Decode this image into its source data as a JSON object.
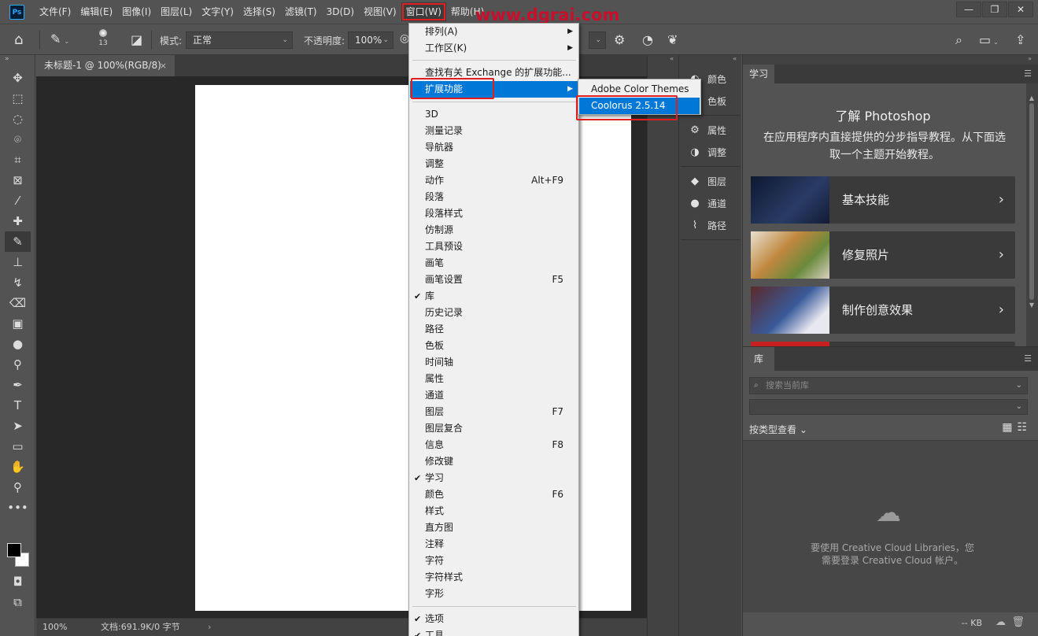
{
  "app": {
    "logo": "Ps",
    "menus": [
      "文件(F)",
      "编辑(E)",
      "图像(I)",
      "图层(L)",
      "文字(Y)",
      "选择(S)",
      "滤镜(T)",
      "3D(D)",
      "视图(V)",
      "窗口(W)",
      "帮助(H)"
    ],
    "active_menu": "窗口(W)",
    "watermark": "www.dgrai.com",
    "window_controls": [
      "—",
      "❐",
      "✕"
    ]
  },
  "options": {
    "brush_size": "13",
    "mode_label": "模式:",
    "mode_value": "正常",
    "opacity_label": "不透明度:",
    "opacity_value": "100%"
  },
  "document": {
    "tab_title": "未标题-1 @ 100%(RGB/8)",
    "tab_close": "×",
    "zoom": "100%",
    "doc_info": "文档:691.9K/0 字节",
    "status_arrow": "›"
  },
  "right_panels": {
    "group1": [
      {
        "icon": "◐",
        "label": "颜色"
      },
      {
        "icon": "▦",
        "label": "色板"
      }
    ],
    "group2": [
      {
        "icon": "⚙",
        "label": "属性"
      },
      {
        "icon": "◑",
        "label": "调整"
      }
    ],
    "group3": [
      {
        "icon": "◆",
        "label": "图层"
      },
      {
        "icon": "●",
        "label": "通道"
      },
      {
        "icon": "⌇",
        "label": "路径"
      }
    ]
  },
  "learn": {
    "tab": "学习",
    "title": "了解 Photoshop",
    "description": "在应用程序内直接提供的分步指导教程。从下面选取一个主题开始教程。",
    "cards": [
      {
        "label": "基本技能",
        "thumb_color": "#1d2a44"
      },
      {
        "label": "修复照片",
        "thumb_color": "#8a6a3a"
      },
      {
        "label": "制作创意效果",
        "thumb_color": "#3a4f7a"
      }
    ]
  },
  "library": {
    "tab": "库",
    "search_placeholder": "搜索当前库",
    "sort_label": "按类型查看",
    "message_line1": "要使用 Creative Cloud Libraries，您",
    "message_line2": "需要登录 Creative Cloud 帐户。",
    "footer_kb": "-- KB"
  },
  "window_menu": {
    "items": [
      {
        "label": "排列(A)",
        "arrow": "▶"
      },
      {
        "label": "工作区(K)",
        "arrow": "▶"
      },
      {
        "label": "查找有关 Exchange 的扩展功能..."
      },
      {
        "label": "扩展功能",
        "arrow": "▶",
        "highlight": true
      },
      {
        "label": "3D"
      },
      {
        "label": "测量记录"
      },
      {
        "label": "导航器"
      },
      {
        "label": "调整"
      },
      {
        "label": "动作",
        "shortcut": "Alt+F9"
      },
      {
        "label": "段落"
      },
      {
        "label": "段落样式"
      },
      {
        "label": "仿制源"
      },
      {
        "label": "工具预设"
      },
      {
        "label": "画笔"
      },
      {
        "label": "画笔设置",
        "shortcut": "F5"
      },
      {
        "label": "库",
        "check": "✔"
      },
      {
        "label": "历史记录"
      },
      {
        "label": "路径"
      },
      {
        "label": "色板"
      },
      {
        "label": "时间轴"
      },
      {
        "label": "属性"
      },
      {
        "label": "通道"
      },
      {
        "label": "图层",
        "shortcut": "F7"
      },
      {
        "label": "图层复合"
      },
      {
        "label": "信息",
        "shortcut": "F8"
      },
      {
        "label": "修改键"
      },
      {
        "label": "学习",
        "check": "✔"
      },
      {
        "label": "颜色",
        "shortcut": "F6"
      },
      {
        "label": "样式"
      },
      {
        "label": "直方图"
      },
      {
        "label": "注释"
      },
      {
        "label": "字符"
      },
      {
        "label": "字符样式"
      },
      {
        "label": "字形"
      },
      {
        "label": "选项",
        "check": "✔"
      },
      {
        "label": "工具",
        "check": "✔"
      }
    ],
    "submenu": [
      {
        "label": "Adobe Color Themes"
      },
      {
        "label": "Coolorus 2.5.14",
        "highlight": true
      }
    ]
  }
}
